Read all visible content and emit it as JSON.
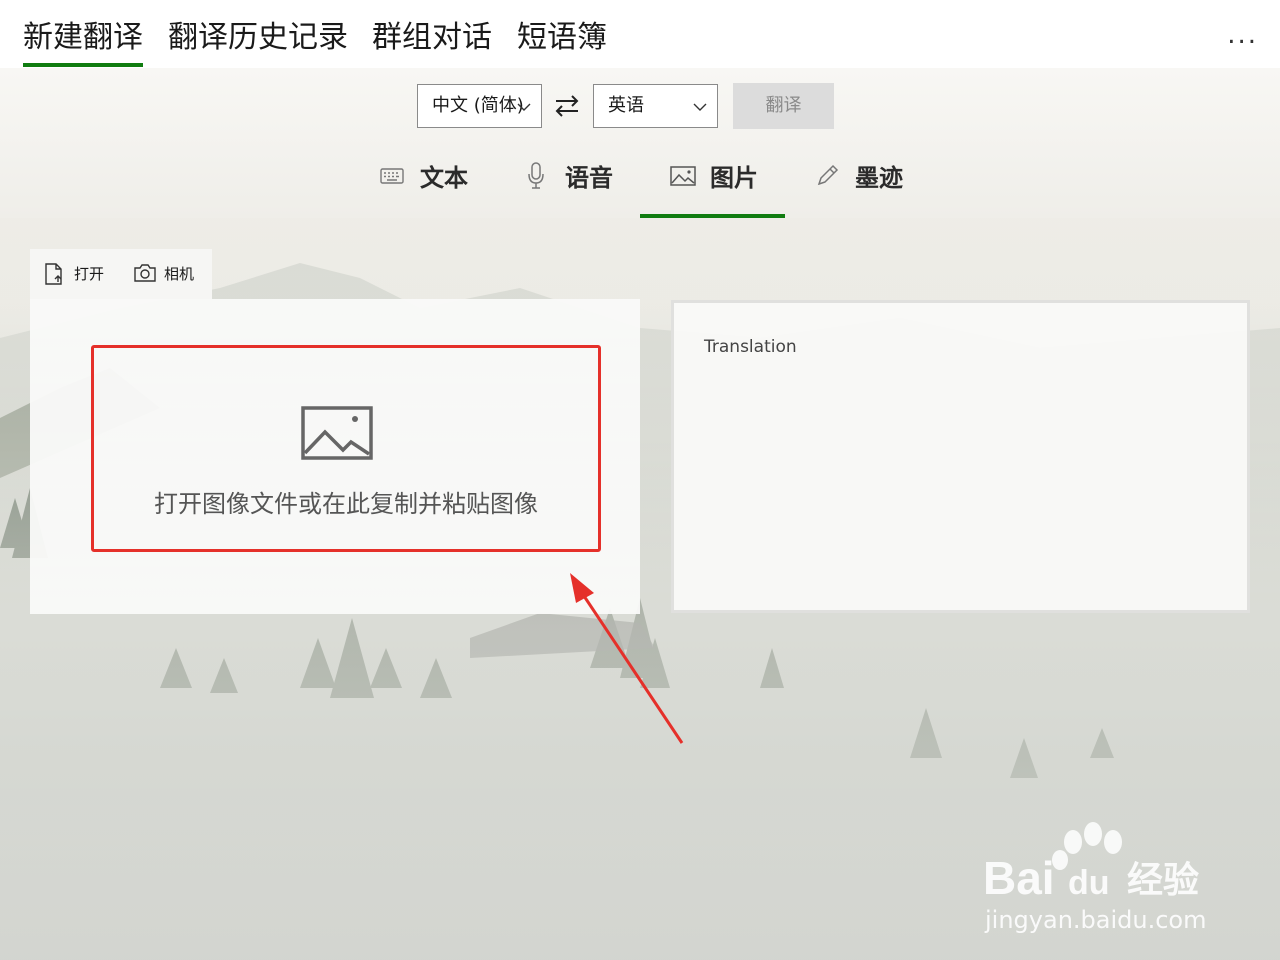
{
  "nav": {
    "tabs": [
      {
        "label": "新建翻译",
        "active": true
      },
      {
        "label": "翻译历史记录",
        "active": false
      },
      {
        "label": "群组对话",
        "active": false
      },
      {
        "label": "短语簿",
        "active": false
      }
    ],
    "more_label": "..."
  },
  "translator": {
    "source_language": "中文 (简体)",
    "target_language": "英语",
    "translate_button": "翻译"
  },
  "modes": [
    {
      "label": "文本",
      "icon": "keyboard-icon",
      "active": false
    },
    {
      "label": "语音",
      "icon": "microphone-icon",
      "active": false
    },
    {
      "label": "图片",
      "icon": "image-icon",
      "active": true
    },
    {
      "label": "墨迹",
      "icon": "pen-icon",
      "active": false
    }
  ],
  "source": {
    "open_label": "打开",
    "camera_label": "相机",
    "drop_hint": "打开图像文件或在此复制并粘贴图像"
  },
  "target": {
    "placeholder": "Translation"
  },
  "watermark": {
    "brand_text": "Bai",
    "brand_text_2": "du",
    "product_text": "经验",
    "url_text": "jingyan.baidu.com"
  },
  "colors": {
    "accent": "#107c10",
    "highlight_box": "#e5302a"
  }
}
